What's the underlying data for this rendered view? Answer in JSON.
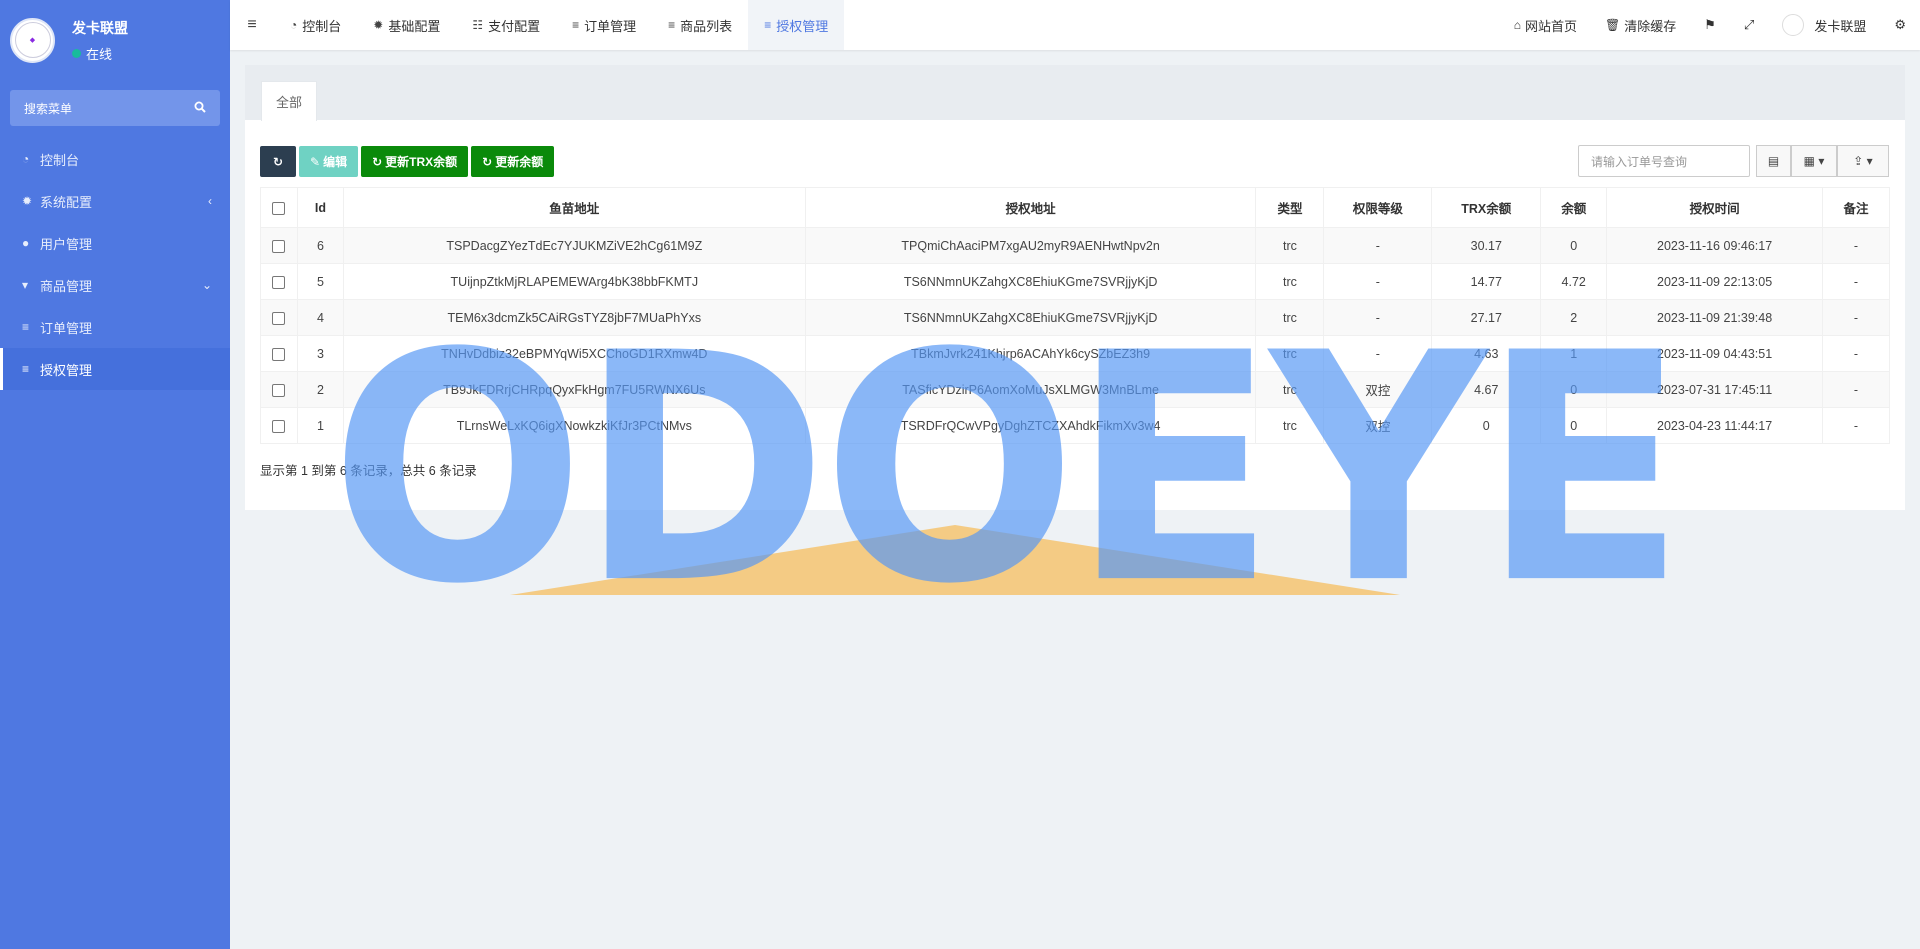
{
  "sidebar": {
    "brand_name": "发卡联盟",
    "status": "在线",
    "search_placeholder": "搜索菜单",
    "items": [
      {
        "label": "控制台",
        "icon": "dashboard-icon"
      },
      {
        "label": "系统配置",
        "icon": "gear-icon"
      },
      {
        "label": "用户管理",
        "icon": "user-icon"
      },
      {
        "label": "商品管理",
        "icon": "cart-icon"
      },
      {
        "label": "订单管理",
        "icon": "list-icon"
      },
      {
        "label": "授权管理",
        "icon": "list-icon"
      }
    ]
  },
  "topbar": {
    "tabs": [
      {
        "label": "控制台",
        "icon": "dashboard-icon"
      },
      {
        "label": "基础配置",
        "icon": "gear-icon"
      },
      {
        "label": "支付配置",
        "icon": "grid-list-icon"
      },
      {
        "label": "订单管理",
        "icon": "list-icon"
      },
      {
        "label": "商品列表",
        "icon": "list-icon"
      },
      {
        "label": "授权管理",
        "icon": "list-icon"
      }
    ],
    "home_label": "网站首页",
    "clear_cache_label": "清除缓存",
    "user_label": "发卡联盟"
  },
  "panel": {
    "tab_all": "全部",
    "buttons": {
      "edit": "编辑",
      "update_trx": "更新TRX余额",
      "update_balance": "更新余额"
    },
    "search_placeholder": "请输入订单号查询",
    "columns": [
      "Id",
      "鱼苗地址",
      "授权地址",
      "类型",
      "权限等级",
      "TRX余额",
      "余额",
      "授权时间",
      "备注"
    ],
    "rows": [
      [
        "6",
        "TSPDacgZYezTdEc7YJUKMZiVE2hCg61M9Z",
        "TPQmiChAaciPM7xgAU2myR9AENHwtNpv2n",
        "trc",
        "-",
        "30.17",
        "0",
        "2023-11-16 09:46:17",
        "-"
      ],
      [
        "5",
        "TUijnpZtkMjRLAPEMEWArg4bK38bbFKMTJ",
        "TS6NNmnUKZahgXC8EhiuKGme7SVRjjyKjD",
        "trc",
        "-",
        "14.77",
        "4.72",
        "2023-11-09 22:13:05",
        "-"
      ],
      [
        "4",
        "TEM6x3dcmZk5CAiRGsTYZ8jbF7MUaPhYxs",
        "TS6NNmnUKZahgXC8EhiuKGme7SVRjjyKjD",
        "trc",
        "-",
        "27.17",
        "2",
        "2023-11-09 21:39:48",
        "-"
      ],
      [
        "3",
        "TNHvDdbiz32eBPMYqWi5XCChoGD1RXmw4D",
        "TBkmJvrk241Khjrp6ACAhYk6cySZbEZ3h9",
        "trc",
        "-",
        "4.63",
        "1",
        "2023-11-09 04:43:51",
        "-"
      ],
      [
        "2",
        "TB9JkFDRrjCHRpqQyxFkHgm7FU5RWNX6Us",
        "TASficYDzirP6AomXoMuJsXLMGW3MnBLme",
        "trc",
        "双控",
        "4.67",
        "0",
        "2023-07-31 17:45:11",
        "-"
      ],
      [
        "1",
        "TLrnsWeLxKQ6igXNowkzkiKfJr3PCtNMvs",
        "TSRDFrQCwVPgyDghZTCZXAhdkFikmXv3w4",
        "trc",
        "双控",
        "0",
        "0",
        "2023-04-23 11:44:17",
        "-"
      ]
    ],
    "pagination_text": "显示第 1 到第 6 条记录，总共 6 条记录"
  },
  "watermark": {
    "text": "ODOEYE",
    "colors": {
      "letters": "#5496f5",
      "triangle": "#f5c470"
    }
  },
  "colors": {
    "sidebar": "#4f78e1",
    "accent": "#4f78e1",
    "green_button": "#0a8a0a",
    "teal_button": "#6fd2c3",
    "dark_button": "#2c3e50"
  }
}
